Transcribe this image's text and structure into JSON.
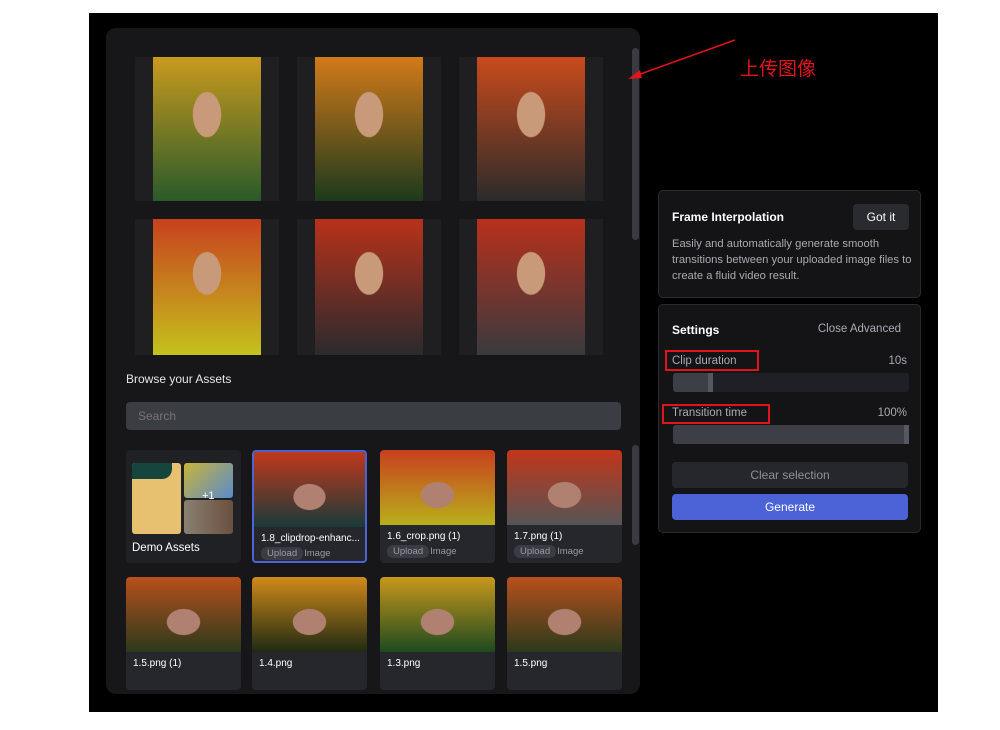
{
  "annotation": {
    "label": "上传图像",
    "color": "#e0141b"
  },
  "gallery": {
    "items": [
      {
        "colors": [
          "#c89a1e",
          "#2a5a2a"
        ]
      },
      {
        "colors": [
          "#d27a1a",
          "#1c3a1c"
        ]
      },
      {
        "colors": [
          "#c94a1c",
          "#2b2b2b"
        ]
      },
      {
        "colors": [
          "#c8401e",
          "#c4c21c"
        ]
      },
      {
        "colors": [
          "#b8321a",
          "#2a2a2e"
        ]
      },
      {
        "colors": [
          "#b8301c",
          "#3a3a3e"
        ]
      }
    ]
  },
  "assets": {
    "title": "Browse your Assets",
    "search_placeholder": "Search",
    "folder": {
      "label": "Demo Assets",
      "extra_count": "+1"
    },
    "items": [
      {
        "name": "1.8_clipdrop-enhanc...",
        "tag": "Upload",
        "type": "Image",
        "selected": true,
        "colors": [
          "#c0391c",
          "#1a3a3a"
        ]
      },
      {
        "name": "1.6_crop.png (1)",
        "tag": "Upload",
        "type": "Image",
        "colors": [
          "#c8401e",
          "#b8b01c"
        ]
      },
      {
        "name": "1.7.png (1)",
        "tag": "Upload",
        "type": "Image",
        "colors": [
          "#c2361a",
          "#555"
        ]
      },
      {
        "name": "1.5.png (1)",
        "colors": [
          "#b8501c",
          "#2a3a1c"
        ]
      },
      {
        "name": "1.4.png",
        "colors": [
          "#d08a1a",
          "#1f2a12"
        ]
      },
      {
        "name": "1.3.png",
        "colors": [
          "#c8981c",
          "#1e4a1e"
        ]
      },
      {
        "name": "1.5.png",
        "colors": [
          "#b8501c",
          "#2a3a1c"
        ]
      }
    ]
  },
  "info": {
    "title": "Frame Interpolation",
    "got_it": "Got it",
    "description": "Easily and automatically generate smooth transitions between your uploaded image files to create a fluid video result."
  },
  "settings": {
    "title": "Settings",
    "close_advanced": "Close Advanced",
    "clip_duration": {
      "label": "Clip duration",
      "value": "10s",
      "fraction": 0.15
    },
    "transition_time": {
      "label": "Transition time",
      "value": "100%",
      "fraction": 1.0
    },
    "clear_selection": "Clear selection",
    "generate": "Generate",
    "accent": "#4b63d6"
  }
}
